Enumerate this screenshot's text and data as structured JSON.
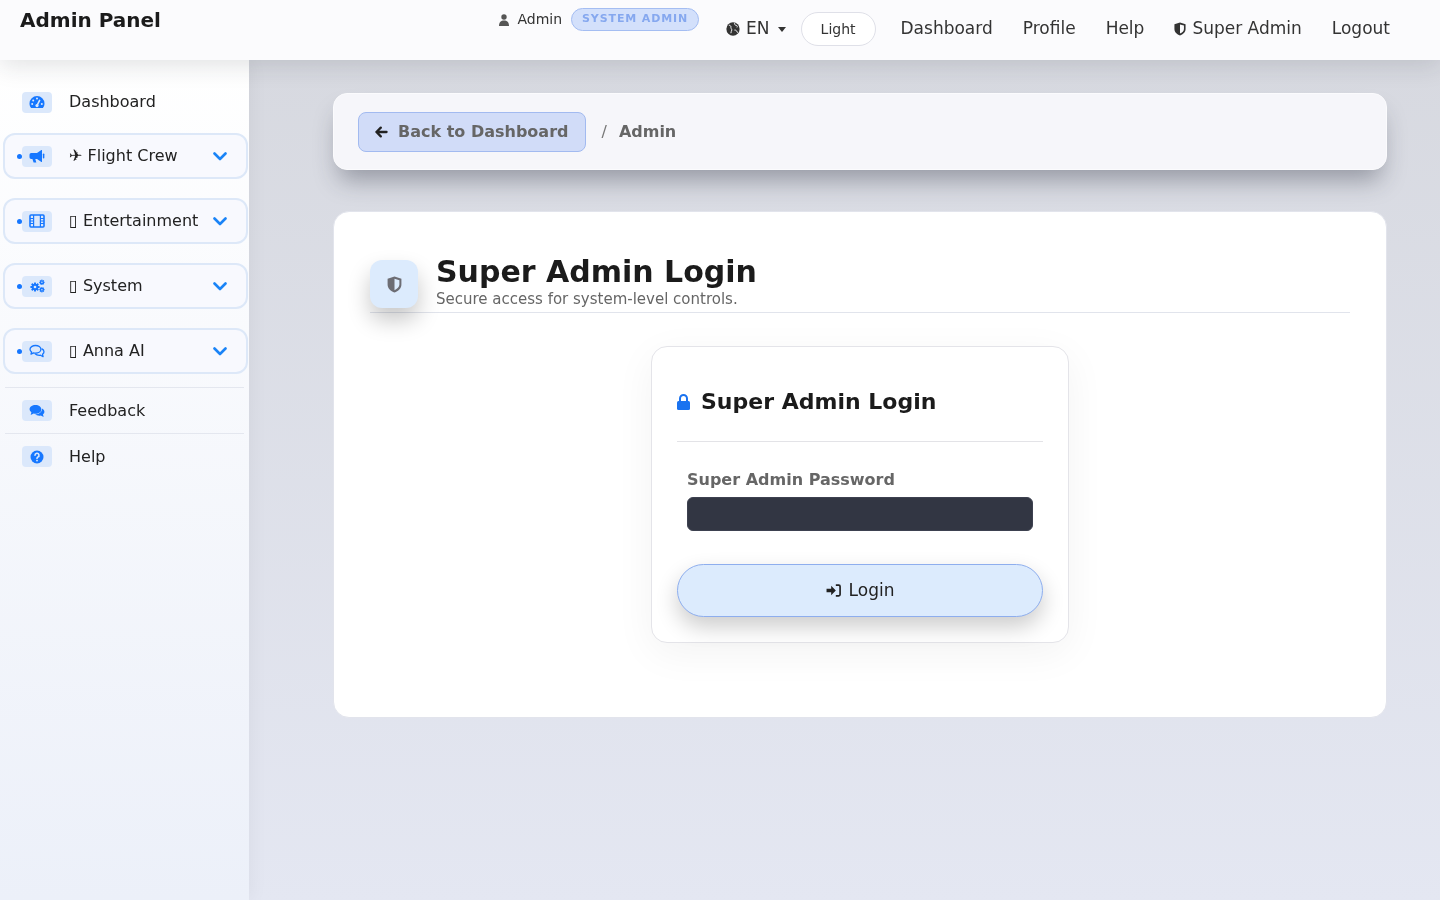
{
  "header": {
    "brand": "Admin Panel",
    "user": {
      "name": "Admin",
      "role": "SYSTEM ADMIN"
    },
    "language": {
      "label": "EN"
    },
    "theme_toggle": {
      "label": "Light"
    },
    "nav": [
      {
        "label": "Dashboard",
        "kind": "text"
      },
      {
        "label": "Profile",
        "kind": "text"
      },
      {
        "label": "Help",
        "kind": "text"
      },
      {
        "label": "Super Admin",
        "kind": "icon"
      },
      {
        "label": "Logout",
        "kind": "text"
      }
    ]
  },
  "sidebar": {
    "items": [
      {
        "kind": "link",
        "label": "Dashboard"
      },
      {
        "kind": "group",
        "label": "✈ Flight Crew",
        "expanded": false
      },
      {
        "kind": "group",
        "label": "▯ Entertainment",
        "expanded": false
      },
      {
        "kind": "group",
        "label": "▯ System",
        "expanded": false
      },
      {
        "kind": "group",
        "label": "▯ Anna AI",
        "expanded": false
      },
      {
        "kind": "link",
        "label": "Feedback"
      },
      {
        "kind": "link",
        "label": "Help"
      }
    ]
  },
  "breadcrumb": {
    "back": "Back to Dashboard",
    "separator": "/",
    "current": "Admin"
  },
  "page_header": {
    "title": "Super Admin Login",
    "subtitle": "Secure access for system-level controls."
  },
  "login_card": {
    "title": "Super Admin Login",
    "password_label": "Super Admin Password",
    "submit": "Login"
  }
}
